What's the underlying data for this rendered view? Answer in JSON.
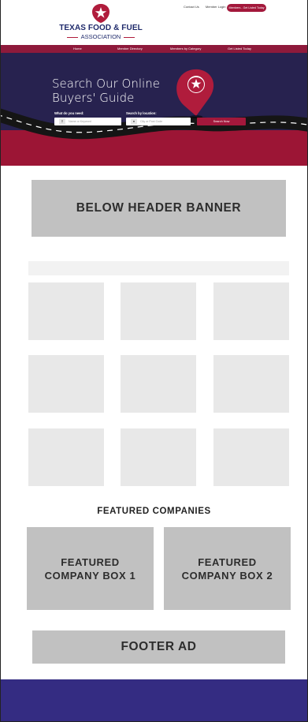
{
  "header": {
    "logo_line1": "TEXAS FOOD & FUEL",
    "logo_line2": "ASSOCIATION",
    "top_links": [
      "Contact Us",
      "Member Login"
    ],
    "join_button": "Members - Get Listed Today"
  },
  "nav": {
    "items": [
      "Home",
      "Member Directory",
      "Members by Category",
      "Get Listed Today"
    ]
  },
  "hero": {
    "title_line1": "Search Our Online",
    "title_line2": "Buyers' Guide",
    "keyword_label": "What do you need:",
    "keyword_placeholder": "Name or Keyword",
    "location_label": "Search by location:",
    "location_placeholder": "City or Post Code",
    "search_button": "Search Now"
  },
  "main": {
    "below_header_banner": "BELOW HEADER BANNER",
    "featured_heading": "FEATURED COMPANIES",
    "featured_boxes": [
      "FEATURED\nCOMPANY BOX 1",
      "FEATURED\nCOMPANY BOX 2"
    ],
    "footer_ad": "FOOTER AD"
  },
  "colors": {
    "brand_red": "#a3183b",
    "nav_red": "#8e1a3b",
    "hero_navy": "#27224f",
    "footer_purple": "#342c82",
    "placeholder_gray": "#c1c1c1",
    "tile_gray": "#e8e8e8"
  }
}
